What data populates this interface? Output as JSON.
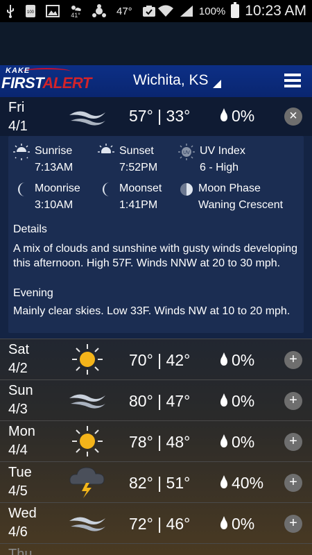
{
  "status_bar": {
    "weather_temp": "41°",
    "temp": "47°",
    "battery": "100%",
    "time": "10:23 AM",
    "icons": [
      "usb-icon",
      "storage-icon",
      "image-icon",
      "weather-icon",
      "connection-icon",
      "cast-icon",
      "wifi-icon",
      "signal-icon",
      "battery-icon"
    ]
  },
  "header": {
    "logo_top": "KAKE",
    "logo_first": "FIRST",
    "logo_alert": "ALERT",
    "location": "Wichita, KS"
  },
  "expanded_day": {
    "day": "Fri",
    "date": "4/1",
    "icon": "windy-icon",
    "temps": "57° | 33°",
    "precip": "0%",
    "toggle": "×",
    "astro": [
      {
        "label": "Sunrise",
        "value": "7:13AM",
        "icon": "sunrise-icon"
      },
      {
        "label": "Sunset",
        "value": "7:52PM",
        "icon": "sunset-icon"
      },
      {
        "label": "UV Index",
        "value": "6 - High",
        "icon": "uv-icon"
      },
      {
        "label": "Moonrise",
        "value": "3:10AM",
        "icon": "moonrise-icon"
      },
      {
        "label": "Moonset",
        "value": "1:41PM",
        "icon": "moonset-icon"
      },
      {
        "label": "Moon Phase",
        "value": "Waning Crescent",
        "icon": "moon-phase-icon"
      }
    ],
    "uv_badge": "UV",
    "details_title": "Details",
    "details_text": "A mix of clouds and sunshine with gusty winds developing this afternoon. High 57F. Winds NNW at 20 to 30 mph.",
    "evening_title": "Evening",
    "evening_text": "Mainly clear skies. Low 33F. Winds NW at 10 to 20 mph."
  },
  "days": [
    {
      "day": "Sat",
      "date": "4/2",
      "icon": "sunny-icon",
      "temps": "70° | 42°",
      "precip": "0%",
      "toggle": "+"
    },
    {
      "day": "Sun",
      "date": "4/3",
      "icon": "windy-icon",
      "temps": "80° | 47°",
      "precip": "0%",
      "toggle": "+"
    },
    {
      "day": "Mon",
      "date": "4/4",
      "icon": "sunny-icon",
      "temps": "78° | 48°",
      "precip": "0%",
      "toggle": "+"
    },
    {
      "day": "Tue",
      "date": "4/5",
      "icon": "thunderstorm-icon",
      "temps": "82° | 51°",
      "precip": "40%",
      "toggle": "+"
    },
    {
      "day": "Wed",
      "date": "4/6",
      "icon": "windy-icon",
      "temps": "72° | 46°",
      "precip": "0%",
      "toggle": "+"
    }
  ],
  "partial_day": "Thu"
}
